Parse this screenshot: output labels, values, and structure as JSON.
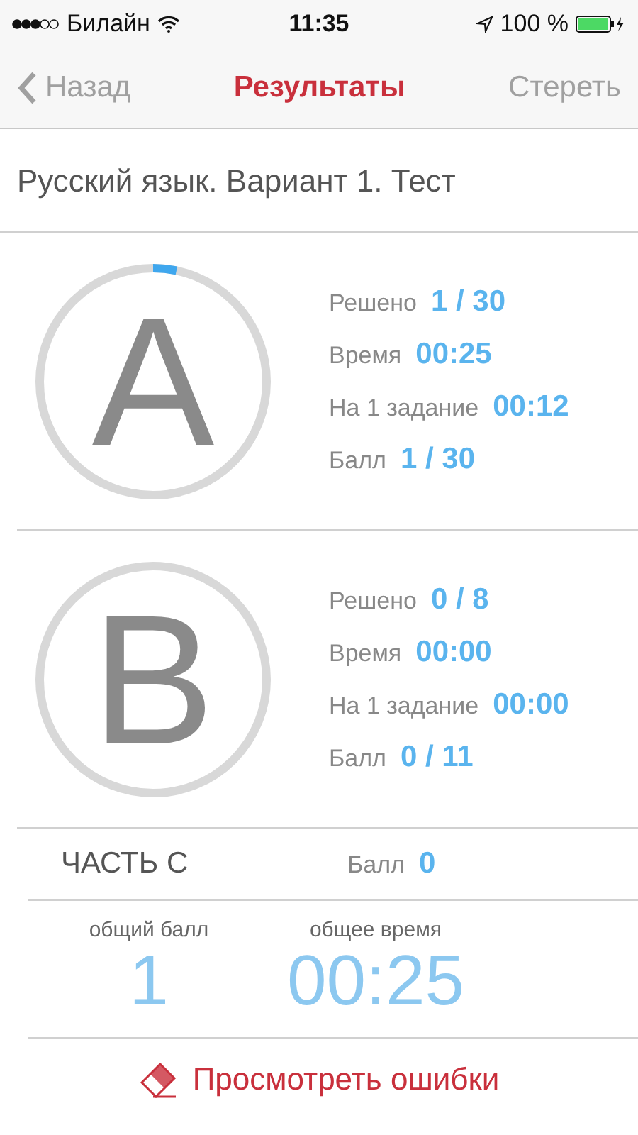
{
  "status_bar": {
    "carrier": "Билайн",
    "time": "11:35",
    "battery": "100 %"
  },
  "nav": {
    "back": "Назад",
    "title": "Результаты",
    "action": "Стереть"
  },
  "subtitle": "Русский язык. Вариант 1. Тест",
  "parts": [
    {
      "letter": "A",
      "level": 0.033,
      "stats": [
        {
          "label": "Решено",
          "value": "1 / 30"
        },
        {
          "label": "Время",
          "value": "00:25"
        },
        {
          "label": "На 1 задание",
          "value": "00:12"
        },
        {
          "label": "Балл",
          "value": "1 / 30"
        }
      ]
    },
    {
      "letter": "B",
      "level": 0,
      "stats": [
        {
          "label": "Решено",
          "value": "0 / 8"
        },
        {
          "label": "Время",
          "value": "00:00"
        },
        {
          "label": "На 1 задание",
          "value": "00:00"
        },
        {
          "label": "Балл",
          "value": "0 / 11"
        }
      ]
    }
  ],
  "part_c": {
    "title": "ЧАСТЬ С",
    "label": "Балл",
    "value": "0"
  },
  "totals": [
    {
      "label": "общий балл",
      "value": "1"
    },
    {
      "label": "общее время",
      "value": "00:25"
    }
  ],
  "review_button": "Просмотреть ошибки"
}
